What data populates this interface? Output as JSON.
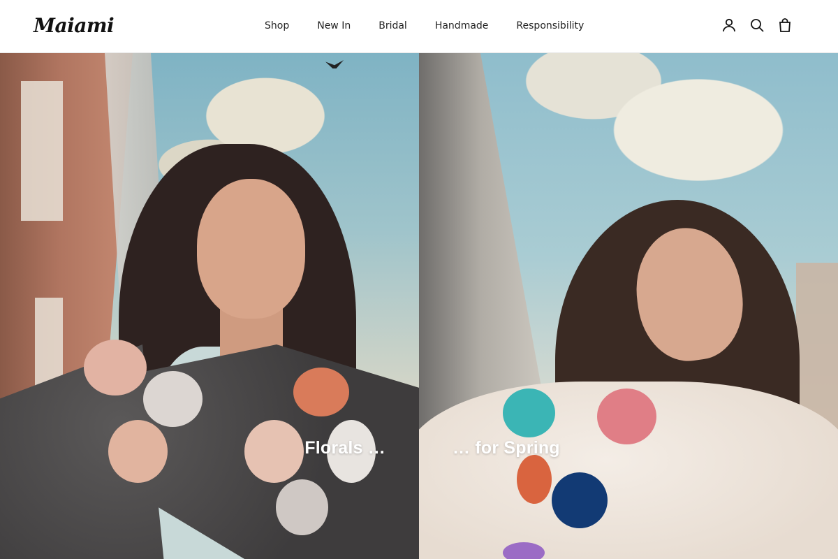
{
  "brand": {
    "logo_text": "Maiami"
  },
  "nav": {
    "items": [
      {
        "label": "Shop"
      },
      {
        "label": "New In"
      },
      {
        "label": "Bridal"
      },
      {
        "label": "Handmade"
      },
      {
        "label": "Responsibility"
      }
    ]
  },
  "header_icons": {
    "account": "user-icon",
    "search": "search-icon",
    "cart": "bag-icon"
  },
  "hero": {
    "left": {
      "caption": "Florals …"
    },
    "right": {
      "caption": "… for Spring"
    }
  },
  "colors": {
    "header_bg": "#ffffff",
    "text": "#111111",
    "hero_caption": "#ffffff"
  }
}
